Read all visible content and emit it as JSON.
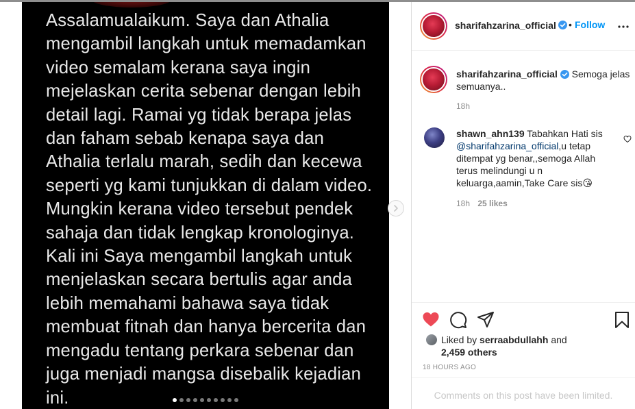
{
  "post": {
    "slide_text": "Assalamualaikum. Saya dan Athalia\nmengambil langkah untuk memadamkan\nvideo semalam kerana saya ingin\nmejelaskan cerita sebenar dengan lebih\ndetail lagi. Ramai yg tidak berapa jelas\ndan faham sebab kenapa saya dan\nAthalia terlalu marah, sedih dan kecewa\nseperti yg kami tunjukkan di dalam video.\nMungkin kerana video tersebut pendek\nsahaja dan tidak lengkap kronologinya.\nKali ini Saya mengambil langkah untuk\nmenjelaskan secara bertulis agar anda\nlebih memahami bahawa saya tidak\nmembuat fitnah dan hanya bercerita dan\nmengadu tentang perkara sebenar dan\njuga menjadi mangsa disebalik kejadian\nini.",
    "slide_count": 10,
    "active_slide": 1
  },
  "header": {
    "username": "sharifahzarina_official",
    "separator": "•",
    "follow_label": "Follow",
    "icons": {
      "avatar": "profile-avatar",
      "verified": "verified-badge-icon",
      "more": "more-options-icon"
    }
  },
  "caption": {
    "username": "sharifahzarina_official",
    "text": "Semoga jelas semuanya..",
    "time": "18h"
  },
  "comments": [
    {
      "username": "shawn_ahn139",
      "text_before": "Tabahkan Hati sis",
      "mention": "@sharifahzarina_official",
      "text_after": ",u tetap ditempat yg benar,,semoga Allah terus melindungi u n keluarga,aamin,Take Care sis",
      "emoji": "😘",
      "time": "18h",
      "likes": "25 likes"
    }
  ],
  "likes": {
    "prefix": "Liked by",
    "user": "serraabdullahh",
    "middle": "and",
    "others": "2,459 others"
  },
  "timestamp": "18 HOURS AGO",
  "comments_limited": "Comments on this post have been limited.",
  "colors": {
    "accent": "#0095f6",
    "like_red": "#ed4956",
    "text": "#262626",
    "muted": "#8e8e8e",
    "mention": "#00376b"
  }
}
